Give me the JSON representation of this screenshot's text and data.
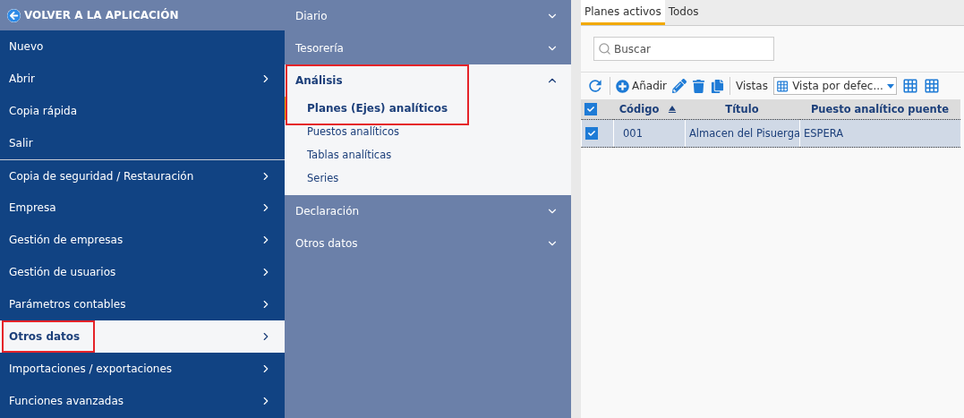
{
  "back_link": {
    "label": "VOLVER A LA APLICACIÓN"
  },
  "main_menu": [
    {
      "label": "Nuevo",
      "has_submenu": false,
      "selected": false,
      "highlighted": false,
      "separator_before": false
    },
    {
      "label": "Abrir",
      "has_submenu": true,
      "selected": false,
      "highlighted": false,
      "separator_before": false
    },
    {
      "label": "Copia rápida",
      "has_submenu": false,
      "selected": false,
      "highlighted": false,
      "separator_before": false
    },
    {
      "label": "Salir",
      "has_submenu": false,
      "selected": false,
      "highlighted": false,
      "separator_before": false
    },
    {
      "label": "Copia de seguridad / Restauración",
      "has_submenu": true,
      "selected": false,
      "highlighted": false,
      "separator_before": true
    },
    {
      "label": "Empresa",
      "has_submenu": true,
      "selected": false,
      "highlighted": false,
      "separator_before": false
    },
    {
      "label": "Gestión de empresas",
      "has_submenu": true,
      "selected": false,
      "highlighted": false,
      "separator_before": false
    },
    {
      "label": "Gestión de usuarios",
      "has_submenu": true,
      "selected": false,
      "highlighted": false,
      "separator_before": false
    },
    {
      "label": "Parámetros contables",
      "has_submenu": true,
      "selected": false,
      "highlighted": false,
      "separator_before": false
    },
    {
      "label": "Otros datos",
      "has_submenu": true,
      "selected": true,
      "highlighted": true,
      "separator_before": false
    },
    {
      "label": "Importaciones / exportaciones",
      "has_submenu": true,
      "selected": false,
      "highlighted": false,
      "separator_before": false
    },
    {
      "label": "Funciones avanzadas",
      "has_submenu": true,
      "selected": false,
      "highlighted": false,
      "separator_before": false
    }
  ],
  "sub_menu": [
    {
      "label": "Diario",
      "expanded": false,
      "highlighted": false
    },
    {
      "label": "Tesorería",
      "expanded": false,
      "highlighted": false
    },
    {
      "label": "Análisis",
      "expanded": true,
      "highlighted": true,
      "children": [
        {
          "label": "Planes (Ejes) analíticos",
          "selected": true
        },
        {
          "label": "Puestos analíticos",
          "selected": false
        },
        {
          "label": "Tablas analíticas",
          "selected": false
        },
        {
          "label": "Series",
          "selected": false
        }
      ]
    },
    {
      "label": "Declaración",
      "expanded": false,
      "highlighted": false
    },
    {
      "label": "Otros datos",
      "expanded": false,
      "highlighted": false
    }
  ],
  "tabs": [
    {
      "label": "Planes activos",
      "selected": true
    },
    {
      "label": "Todos",
      "selected": false
    }
  ],
  "search": {
    "placeholder": "Buscar"
  },
  "toolbar": {
    "add_label": "Añadir",
    "views_label": "Vistas",
    "views_value": "Vista por defec..."
  },
  "table": {
    "header_checked": true,
    "columns": [
      {
        "label": "Código",
        "sorted": true
      },
      {
        "label": "Título",
        "sorted": false
      },
      {
        "label": "Puesto analítico puente",
        "sorted": false
      }
    ],
    "rows": [
      {
        "checked": true,
        "selected": true,
        "cells": [
          "001",
          "Almacen del Pisuerga",
          "ESPERA"
        ]
      }
    ]
  }
}
